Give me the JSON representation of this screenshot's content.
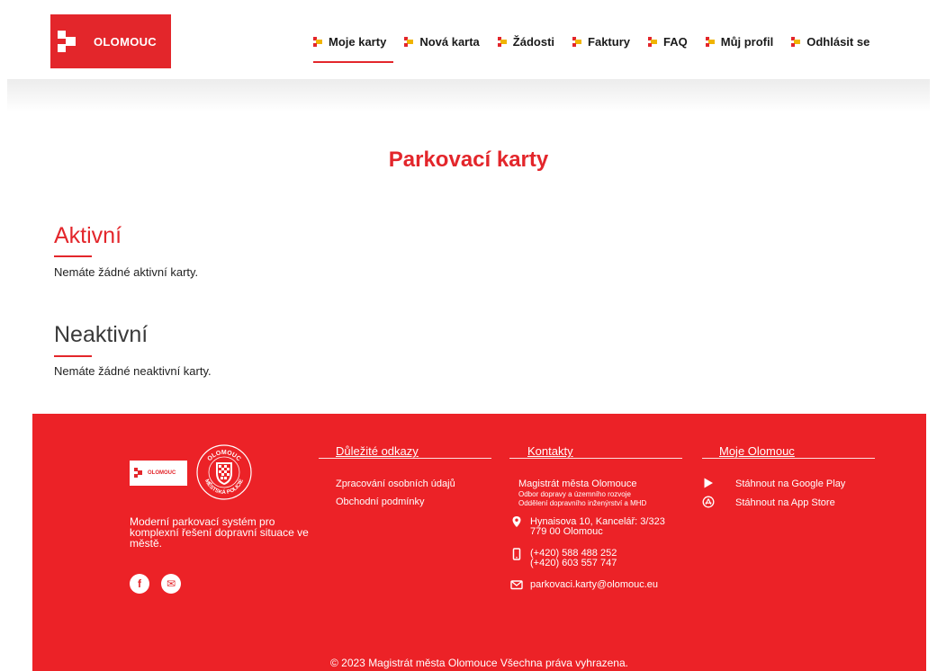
{
  "header": {
    "logo_text": "OLOMOUC",
    "nav": [
      {
        "label": "Moje karty",
        "active": true
      },
      {
        "label": "Nová karta"
      },
      {
        "label": "Žádosti"
      },
      {
        "label": "Faktury"
      },
      {
        "label": "FAQ"
      },
      {
        "label": "Můj profil"
      },
      {
        "label": "Odhlásit se"
      }
    ]
  },
  "main": {
    "title": "Parkovací karty",
    "active": {
      "title": "Aktivní",
      "empty_text": "Nemáte žádné aktivní karty."
    },
    "inactive": {
      "title": "Neaktivní",
      "empty_text": "Nemáte žádné neaktivní karty."
    }
  },
  "footer": {
    "logo_text": "OLOMOUC",
    "seal_text_top": "OLOMOUC",
    "seal_text_bottom": "MĚSTSKÁ POLICIE",
    "description": "Moderní parkovací systém pro komplexní řešení dopravní situace ve městě.",
    "social": [
      {
        "icon": "facebook-icon",
        "glyph": "f"
      },
      {
        "icon": "mail-icon",
        "glyph": "✉"
      }
    ],
    "links": {
      "heading": "Důležité odkazy",
      "items": [
        "Zpracování osobních údajů",
        "Obchodní podmínky"
      ]
    },
    "contacts": {
      "heading": "Kontakty",
      "org": "Magistrát města Olomouce",
      "dept1": "Odbor dopravy a územního rozvoje",
      "dept2": "Oddělení dopravního inženýrství a MHD",
      "address1": "Hynaisova 10, Kancelář: 3/323",
      "address2": "779 00 Olomouc",
      "phone1": "(+420) 588 488 252",
      "phone2": "(+420) 603 557 747",
      "email": "parkovaci.karty@olomouc.eu"
    },
    "moje": {
      "heading": "Moje Olomouc",
      "google_play": "Stáhnout na Google Play",
      "app_store": "Stáhnout na App Store"
    },
    "copyright": "© 2023 Magistrát města Olomouce Všechna práva vyhrazena."
  },
  "colors": {
    "brand_red": "#e3262b",
    "footer_red": "#ec2227"
  }
}
